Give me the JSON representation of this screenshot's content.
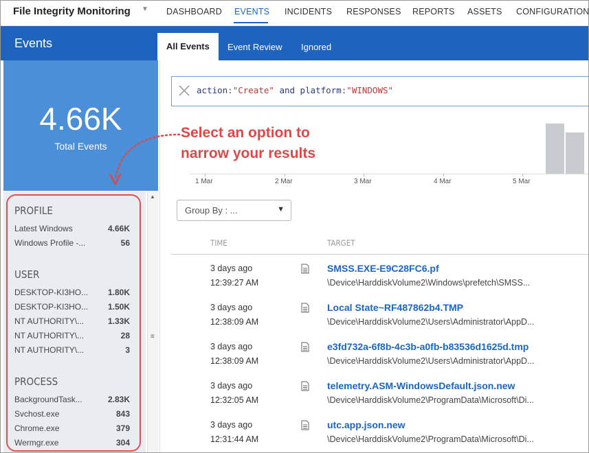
{
  "app": {
    "title": "File Integrity Monitoring"
  },
  "nav": {
    "items": [
      {
        "label": "DASHBOARD"
      },
      {
        "label": "EVENTS"
      },
      {
        "label": "INCIDENTS"
      },
      {
        "label": "RESPONSES"
      },
      {
        "label": "REPORTS"
      },
      {
        "label": "ASSETS"
      },
      {
        "label": "CONFIGURATION"
      }
    ],
    "active": "EVENTS"
  },
  "header": {
    "title": "Events",
    "tabs": [
      {
        "label": "All Events"
      },
      {
        "label": "Event Review"
      },
      {
        "label": "Ignored"
      }
    ],
    "active_tab": "All Events"
  },
  "summary": {
    "total": "4.66K",
    "label": "Total Events"
  },
  "facets": {
    "profile": {
      "title": "PROFILE",
      "items": [
        {
          "label": "Latest Windows",
          "count": "4.66K"
        },
        {
          "label": "Windows Profile -...",
          "count": "56"
        }
      ]
    },
    "user": {
      "title": "USER",
      "items": [
        {
          "label": "DESKTOP-KI3HO...",
          "count": "1.80K"
        },
        {
          "label": "DESKTOP-KI3HO...",
          "count": "1.50K"
        },
        {
          "label": "NT AUTHORITY\\...",
          "count": "1.33K"
        },
        {
          "label": "NT AUTHORITY\\...",
          "count": "28"
        },
        {
          "label": "NT AUTHORITY\\...",
          "count": "3"
        }
      ]
    },
    "process": {
      "title": "PROCESS",
      "items": [
        {
          "label": "BackgroundTask...",
          "count": "2.83K"
        },
        {
          "label": "Svchost.exe",
          "count": "843"
        },
        {
          "label": "Chrome.exe",
          "count": "379"
        },
        {
          "label": "Wermgr.exe",
          "count": "304"
        }
      ]
    }
  },
  "search": {
    "k1": "action",
    "v1": "\"Create\"",
    "op": "and",
    "k2": "platform",
    "v2": "\"WINDOWS\""
  },
  "callout": {
    "line1": "Select an option to",
    "line2": "narrow your results"
  },
  "timeline": {
    "labels": [
      "1 Mar",
      "2 Mar",
      "3 Mar",
      "4 Mar",
      "5 Mar"
    ],
    "bar_color": "#c8ccd0"
  },
  "groupby": {
    "label": "Group By : ..."
  },
  "table": {
    "headers": {
      "time": "TIME",
      "target": "TARGET"
    },
    "rows": [
      {
        "date": "3 days ago",
        "time": "12:39:27 AM",
        "name": "SMSS.EXE-E9C28FC6.pf",
        "path": "\\Device\\HarddiskVolume2\\Windows\\prefetch\\SMSS..."
      },
      {
        "date": "3 days ago",
        "time": "12:38:09 AM",
        "name": "Local State~RF487862b4.TMP",
        "path": "\\Device\\HarddiskVolume2\\Users\\Administrator\\AppD..."
      },
      {
        "date": "3 days ago",
        "time": "12:38:09 AM",
        "name": "e3fd732a-6f8b-4c3b-a0fb-b83536d1625d.tmp",
        "path": "\\Device\\HarddiskVolume2\\Users\\Administrator\\AppD..."
      },
      {
        "date": "3 days ago",
        "time": "12:32:05 AM",
        "name": "telemetry.ASM-WindowsDefault.json.new",
        "path": "\\Device\\HarddiskVolume2\\ProgramData\\Microsoft\\Di..."
      },
      {
        "date": "3 days ago",
        "time": "12:31:44 AM",
        "name": "utc.app.json.new",
        "path": "\\Device\\HarddiskVolume2\\ProgramData\\Microsoft\\Di..."
      }
    ]
  },
  "colors": {
    "brand": "#1e63bd",
    "accent": "#1a66c2",
    "callout": "#e04848",
    "summary_bg": "#4a8fd8"
  }
}
